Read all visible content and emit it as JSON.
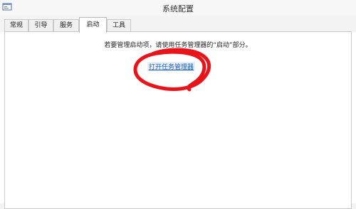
{
  "window": {
    "title": "系统配置",
    "app_icon": "msconfig-icon"
  },
  "tabs": [
    {
      "label": "常规",
      "active": false
    },
    {
      "label": "引导",
      "active": false
    },
    {
      "label": "服务",
      "active": false
    },
    {
      "label": "启动",
      "active": true
    },
    {
      "label": "工具",
      "active": false
    }
  ],
  "startup_panel": {
    "info_text": "若要管理启动项，请使用任务管理器的“启动”部分。",
    "open_task_manager_link": "打开任务管理器"
  },
  "annotation": {
    "shape": "hand-drawn ellipse",
    "color": "#e8141a"
  }
}
